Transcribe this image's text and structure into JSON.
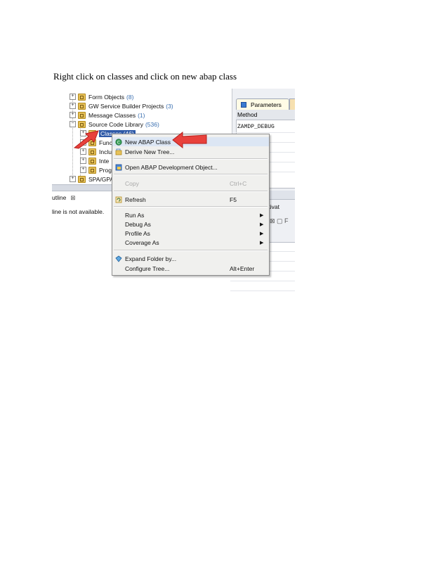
{
  "caption": "Right click on classes and click on new abap class",
  "tree": {
    "items": [
      {
        "label": "Form Objects",
        "count": "(8)",
        "expander": "+"
      },
      {
        "label": "GW Service Builder Projects",
        "count": "(3)",
        "expander": "+"
      },
      {
        "label": "Message Classes",
        "count": "(1)",
        "expander": "+"
      },
      {
        "label": "Source Code Library",
        "count": "(536)",
        "expander": "−"
      }
    ],
    "children": [
      {
        "label": "Classes (46)",
        "expander": "+"
      },
      {
        "label": "Func",
        "expander": "+"
      },
      {
        "label": "Inclu",
        "expander": "+"
      },
      {
        "label": "Inte",
        "expander": "+"
      },
      {
        "label": "Prog",
        "expander": "+"
      }
    ],
    "last_item": {
      "label": "SPA/GPA",
      "expander": "+"
    }
  },
  "outline": {
    "tab_label": "utline",
    "close_glyph": "⊠",
    "message": "line is not available."
  },
  "right_panel": {
    "tab_label": "Parameters",
    "column_header": "Method",
    "method_value": "ZAMDP_DEBUG",
    "status_text": "s) activat",
    "icons_text": "⊠ ▢ F"
  },
  "context_menu": {
    "items": [
      {
        "label": "New ABAP Class",
        "shortcut": "",
        "icon": "new-class-icon",
        "submenu": false,
        "disabled": false
      },
      {
        "label": "Derive New Tree...",
        "shortcut": "",
        "icon": "derive-tree-icon",
        "submenu": false,
        "disabled": false
      },
      {
        "label": "Open ABAP Development Object...",
        "shortcut": "",
        "icon": "open-object-icon",
        "submenu": false,
        "disabled": false
      },
      {
        "label": "Copy",
        "shortcut": "Ctrl+C",
        "icon": "",
        "submenu": false,
        "disabled": true
      },
      {
        "label": "Refresh",
        "shortcut": "F5",
        "icon": "refresh-icon",
        "submenu": false,
        "disabled": false
      },
      {
        "label": "Run As",
        "shortcut": "",
        "icon": "",
        "submenu": true,
        "disabled": false
      },
      {
        "label": "Debug As",
        "shortcut": "",
        "icon": "",
        "submenu": true,
        "disabled": false
      },
      {
        "label": "Profile As",
        "shortcut": "",
        "icon": "",
        "submenu": true,
        "disabled": false
      },
      {
        "label": "Coverage As",
        "shortcut": "",
        "icon": "",
        "submenu": true,
        "disabled": false
      },
      {
        "label": "Expand Folder by...",
        "shortcut": "",
        "icon": "expand-folder-icon",
        "submenu": false,
        "disabled": false
      },
      {
        "label": "Configure Tree...",
        "shortcut": "Alt+Enter",
        "icon": "",
        "submenu": false,
        "disabled": false
      }
    ]
  },
  "colors": {
    "arrow": "#e8413c",
    "selection": "#2f5aa8",
    "count_text": "#3a6fb0"
  }
}
